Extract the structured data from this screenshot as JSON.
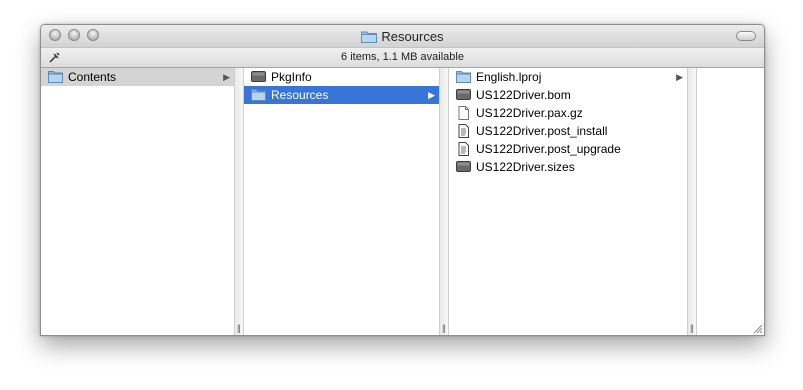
{
  "window": {
    "title": "Resources",
    "title_icon": "folder-icon",
    "status_text": "6 items, 1.1 MB available"
  },
  "columns": [
    {
      "items": [
        {
          "label": "Contents",
          "icon": "folder-icon",
          "has_children": true,
          "selected": "inactive"
        }
      ]
    },
    {
      "items": [
        {
          "label": "PkgInfo",
          "icon": "document-icon",
          "has_children": false,
          "selected": "none"
        },
        {
          "label": "Resources",
          "icon": "folder-icon",
          "has_children": true,
          "selected": "active"
        }
      ]
    },
    {
      "items": [
        {
          "label": "English.lproj",
          "icon": "folder-icon",
          "has_children": true,
          "selected": "none"
        },
        {
          "label": "US122Driver.bom",
          "icon": "document-icon",
          "has_children": false,
          "selected": "none"
        },
        {
          "label": "US122Driver.pax.gz",
          "icon": "blank-file-icon",
          "has_children": false,
          "selected": "none"
        },
        {
          "label": "US122Driver.post_install",
          "icon": "script-file-icon",
          "has_children": false,
          "selected": "none"
        },
        {
          "label": "US122Driver.post_upgrade",
          "icon": "script-file-icon",
          "has_children": false,
          "selected": "none"
        },
        {
          "label": "US122Driver.sizes",
          "icon": "document-icon",
          "has_children": false,
          "selected": "none"
        }
      ]
    },
    {
      "items": []
    }
  ],
  "colors": {
    "selection_active": "#3875d7",
    "selection_inactive": "#d4d4d4"
  }
}
